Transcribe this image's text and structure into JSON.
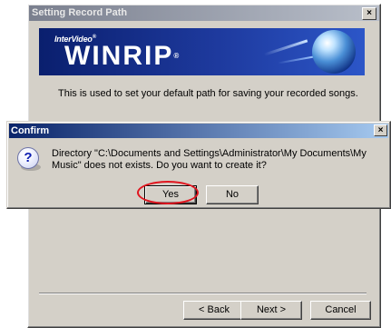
{
  "wizard": {
    "title": "Setting Record Path",
    "close_glyph": "×",
    "banner": {
      "brand": "InterVideo",
      "brand_reg": "®",
      "product": "WINRIP",
      "product_reg": "®",
      "globe_icon": "globe-icon"
    },
    "description": "This is used to set your default path for saving your recorded songs.",
    "buttons": {
      "back": "< Back",
      "next": "Next >",
      "cancel": "Cancel"
    }
  },
  "confirm": {
    "title": "Confirm",
    "close_glyph": "×",
    "icon": "question-icon",
    "icon_glyph": "?",
    "message": "Directory \"C:\\Documents and Settings\\Administrator\\My Documents\\My Music\" does not exists. Do you want to create it?",
    "buttons": {
      "yes": "Yes",
      "no": "No"
    },
    "highlight_color": "#e0141e"
  },
  "colors": {
    "dialog_face": "#d4d0c8",
    "active_title": "#0a246a",
    "inactive_title": "#7a7f8e",
    "banner": "#1e3a9e"
  }
}
